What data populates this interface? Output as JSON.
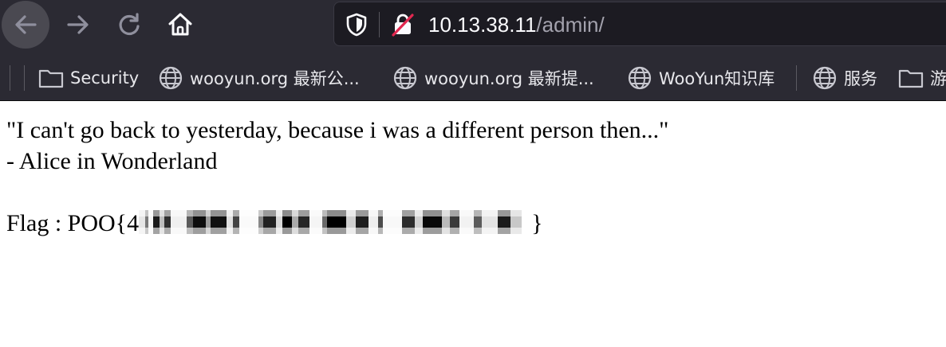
{
  "browser": {
    "url_host": "10.13.38.11",
    "url_path": "/admin/",
    "accent_color": "#2b2a33"
  },
  "nav": {
    "back_icon": "arrow-left-icon",
    "forward_icon": "arrow-right-icon",
    "reload_icon": "reload-icon",
    "home_icon": "home-icon"
  },
  "bookmarks": {
    "items": [
      {
        "label": "Security",
        "icon": "folder-icon"
      },
      {
        "label": "wooyun.org 最新公...",
        "icon": "globe-icon"
      },
      {
        "label": "wooyun.org 最新提...",
        "icon": "globe-icon"
      },
      {
        "label": "WooYun知识库",
        "icon": "globe-icon"
      },
      {
        "label": "服务",
        "icon": "globe-icon"
      },
      {
        "label": "游",
        "icon": "folder-icon"
      }
    ]
  },
  "page": {
    "quote": "\"I can't go back to yesterday, because i was a different person then...\"",
    "attribution": "- Alice in Wonderland",
    "flag_prefix": "Flag : POO{4",
    "flag_suffix": "}"
  }
}
